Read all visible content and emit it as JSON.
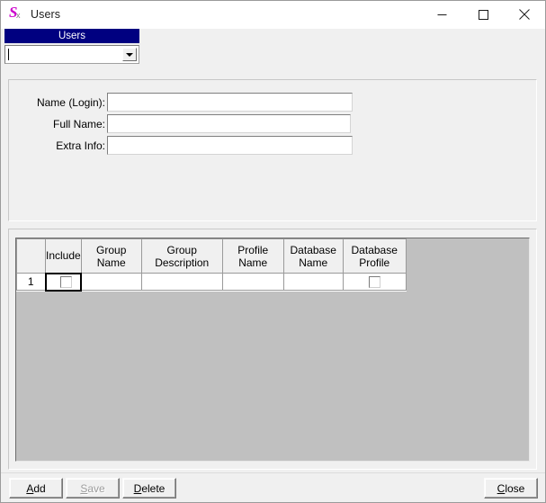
{
  "window": {
    "title": "Users",
    "icon": "app-s-icon",
    "icon_letter": "S",
    "icon_sub": "x",
    "controls": {
      "minimize": "minimize-icon",
      "maximize": "maximize-icon",
      "close": "close-icon"
    }
  },
  "selector": {
    "header_label": "Users",
    "header_bg": "#000080",
    "header_fg": "#ffffff",
    "combo_value": "",
    "combo_placeholder": "",
    "dropdown_icon": "chevron-down-icon"
  },
  "form": {
    "fields": [
      {
        "label": "Name (Login):",
        "value": "",
        "placeholder": ""
      },
      {
        "label": "Full Name:",
        "value": "",
        "placeholder": ""
      },
      {
        "label": "Extra Info:",
        "value": "",
        "placeholder": ""
      }
    ]
  },
  "grid": {
    "corner_header": "",
    "columns": [
      "Include",
      "Group Name",
      "Group Description",
      "Profile Name",
      "Database\nName",
      "Database\nProfile"
    ],
    "columns_display": [
      "Include",
      "Group Name",
      "Group Description",
      "Profile Name",
      "Database Name",
      "Database Profile"
    ],
    "rows": [
      {
        "row_number": "1",
        "include_checked": false,
        "group_name": "",
        "group_description": "",
        "profile_name": "",
        "database_name": "",
        "database_profile_checked": false
      }
    ],
    "empty_bg": "#c0c0c0"
  },
  "buttons": {
    "add": {
      "label": "Add",
      "accel": "A",
      "enabled": true
    },
    "save": {
      "label": "Save",
      "accel": "S",
      "enabled": false
    },
    "delete": {
      "label": "Delete",
      "accel": "D",
      "enabled": true
    },
    "close": {
      "label": "Close",
      "accel": "C",
      "enabled": true
    }
  }
}
